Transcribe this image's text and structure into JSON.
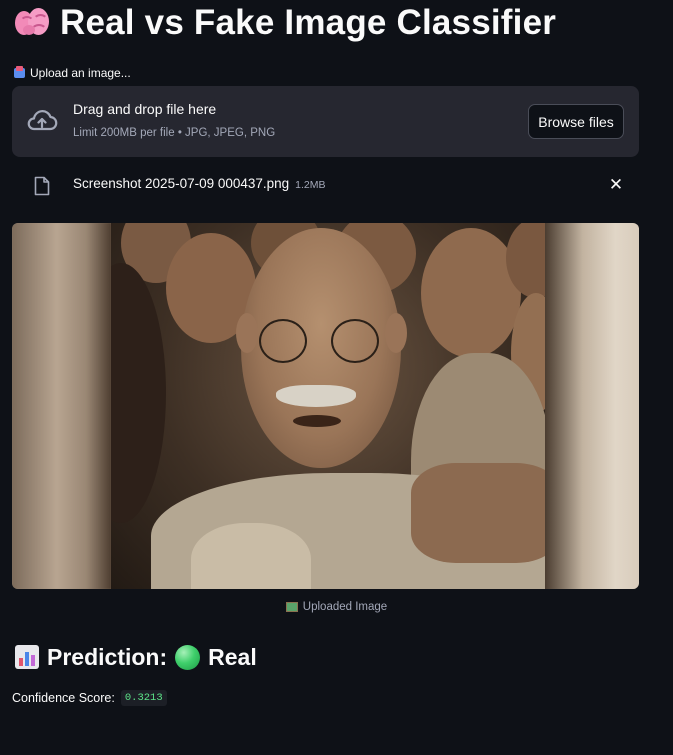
{
  "header": {
    "emoji_icon": "brain-icon",
    "title": "Real vs Fake Image Classifier"
  },
  "uploader": {
    "label": "Upload an image...",
    "dropzone_title": "Drag and drop file here",
    "dropzone_sub": "Limit 200MB per file • JPG, JPEG, PNG",
    "browse_label": "Browse files"
  },
  "file": {
    "name": "Screenshot 2025-07-09 000437.png",
    "size": "1.2MB",
    "close_glyph": "✕"
  },
  "image": {
    "caption": "Uploaded Image"
  },
  "result": {
    "prediction_label": "Prediction:",
    "prediction_value": "Real",
    "confidence_label": "Confidence Score:",
    "confidence_value": "0.3213"
  },
  "colors": {
    "background": "#0e1117",
    "dropzone": "#262730",
    "accent_green": "#5ce488"
  }
}
